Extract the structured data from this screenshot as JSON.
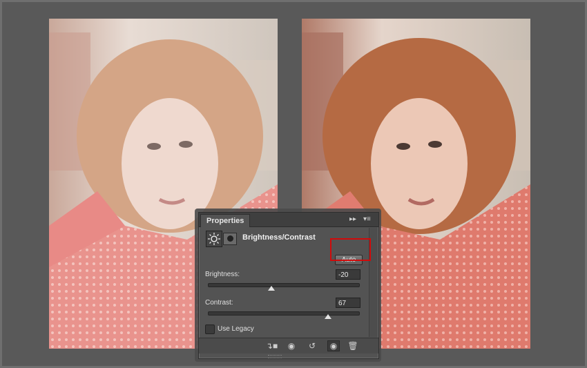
{
  "panel": {
    "tab_label": "Properties",
    "collapse_icon": "double-chevron-right-icon",
    "menu_icon": "panel-menu-icon",
    "adjustment_icon": "brightness-sun-icon",
    "mask_icon": "layer-mask-icon",
    "title": "Brightness/Contrast",
    "auto_label": "Auto",
    "brightness": {
      "label": "Brightness:",
      "value": "-20",
      "level_pct": 42
    },
    "contrast": {
      "label": "Contrast:",
      "value": "67",
      "level_pct": 80
    },
    "legacy_label": "Use Legacy",
    "footer_icons": [
      "clip-to-layer-icon",
      "view-previous-state-icon",
      "reset-icon",
      "visibility-eye-icon",
      "trash-icon"
    ]
  },
  "images": {
    "before": {
      "description_icon": "portrait-photo"
    },
    "after": {
      "description_icon": "portrait-photo"
    }
  },
  "colors": {
    "accent_highlight": "#d10a0a",
    "sweater_before": "#e88a86",
    "sweater_after": "#e07c70",
    "hair_before": "#cf9a7a",
    "hair_after": "#b86a45"
  }
}
